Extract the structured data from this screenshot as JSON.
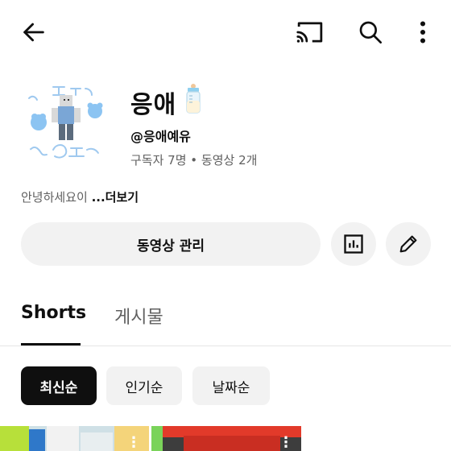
{
  "header": {
    "back_icon": "arrow-left-icon",
    "cast_icon": "cast-icon",
    "search_icon": "search-icon",
    "more_icon": "more-vertical-icon"
  },
  "channel": {
    "name": "응애",
    "name_emoji_icon": "baby-bottle-icon",
    "handle": "@응애예유",
    "stats": "구독자 7명 • 동영상 2개",
    "description": "안녕하세요이 ",
    "more_label": "...더보기",
    "avatar_icon": "avatar-icon"
  },
  "actions": {
    "manage_label": "동영상 관리",
    "analytics_icon": "bar-chart-icon",
    "edit_icon": "pencil-icon"
  },
  "tabs": [
    {
      "label": "Shorts",
      "selected": true
    },
    {
      "label": "게시물",
      "selected": false
    }
  ],
  "chips": [
    {
      "label": "최신순",
      "selected": true
    },
    {
      "label": "인기순",
      "selected": false
    },
    {
      "label": "날짜순",
      "selected": false
    }
  ],
  "colors": {
    "text_primary": "#0f0f0f",
    "text_secondary": "#606060",
    "chip_bg": "#f2f2f2",
    "chip_selected_bg": "#0f0f0f"
  }
}
